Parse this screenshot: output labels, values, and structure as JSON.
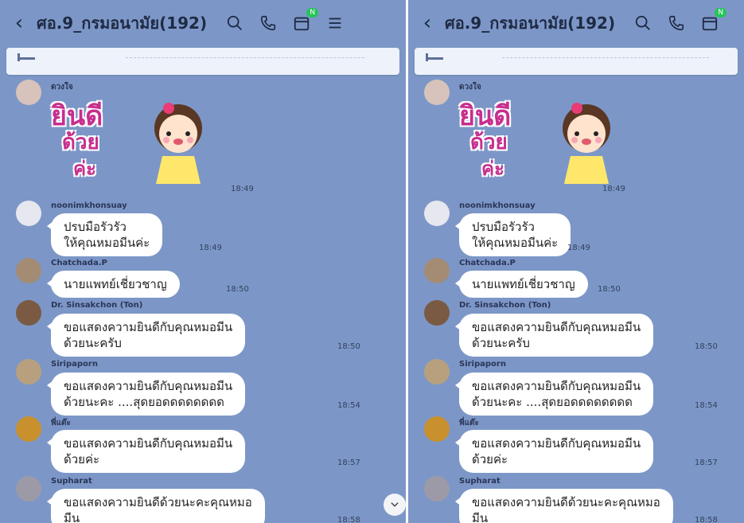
{
  "header": {
    "back_icon": "‹",
    "title": "ศอ.9_กรมอนามัย(192)",
    "calendar_badge": "N"
  },
  "sticker": {
    "line1": "ยินดี",
    "line2": "ด้วย",
    "line3": "ค่ะ"
  },
  "messages": [
    {
      "sender": "ดวงใจ",
      "time": "18:49"
    },
    {
      "sender": "noonimkhonsuay",
      "text_line1": "ปรบมือรัวรัว",
      "text_line2": "ให้คุณหมอมีนค่ะ",
      "time": "18:49"
    },
    {
      "sender": "Chatchada.P",
      "text_line1": "นายแพทย์เชี่ยวชาญ",
      "time": "18:50"
    },
    {
      "sender": "Dr. Sinsakchon (Ton)",
      "text_line1": "ขอแสดงความยินดีกับคุณหมอมีน",
      "text_line2": "ด้วยนะครับ",
      "time": "18:50"
    },
    {
      "sender": "Siripaporn",
      "text_line1": "ขอแสดงความยินดีกับคุณหมอมีน",
      "text_line2": "ด้วยนะคะ ....สุดยอดดดดดดดด",
      "time": "18:54"
    },
    {
      "sender": "พี่แต๊ะ",
      "text_line1": "ขอแสดงความยินดีกับคุณหมอมีน",
      "text_line2": "ด้วยค่ะ",
      "time": "18:57"
    },
    {
      "sender": "Supharat",
      "text_line1": "ขอแสดงความยินดีด้วยนะคะคุณหมอ",
      "text_line2": "มีน",
      "time": "18:58"
    }
  ],
  "colors": {
    "chat_bg": "#7c97c7",
    "bubble": "#ffffff",
    "header_text": "#1f2a44",
    "badge": "#27c35a"
  }
}
